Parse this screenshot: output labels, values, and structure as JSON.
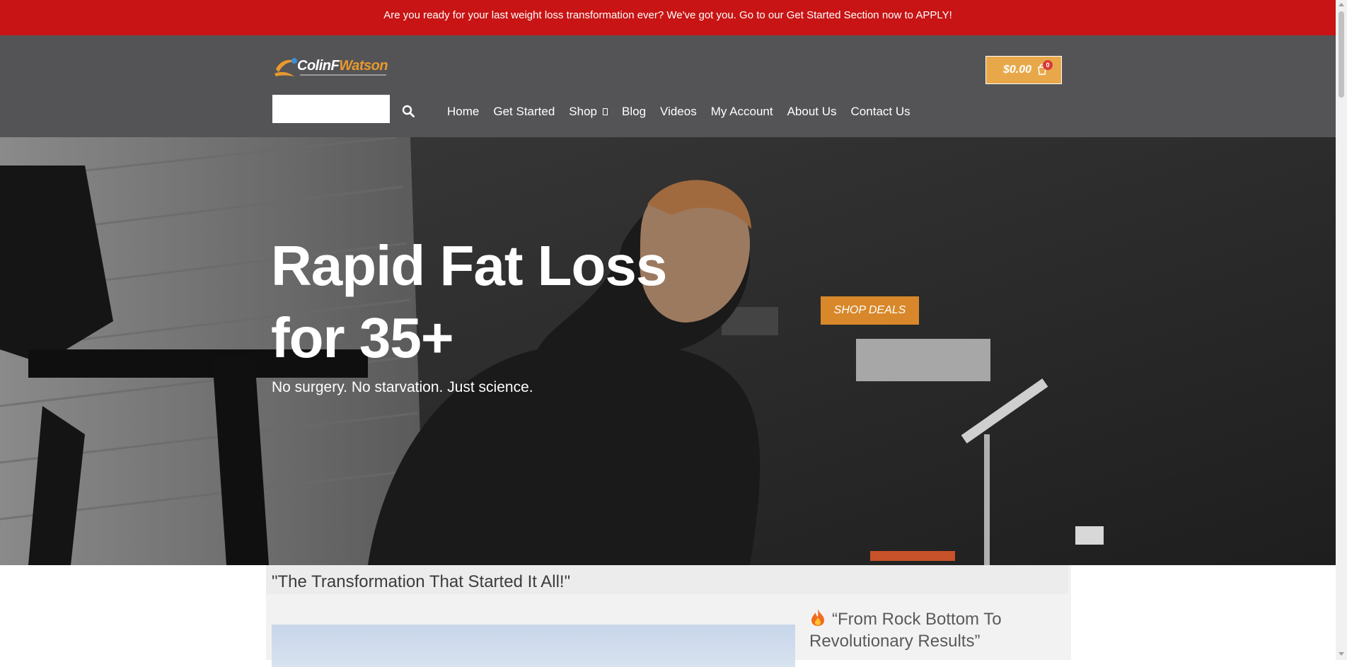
{
  "promo": {
    "text": "Are you ready for your last weight loss transformation ever? We've got you. Go to our Get Started Section now to APPLY!",
    "background": "#c81414"
  },
  "header": {
    "logo": {
      "text_main": "ColinF",
      "text_accent": "Watson"
    },
    "cart": {
      "amount": "$0.00",
      "count": "0",
      "background": "#e8a84a"
    },
    "search": {
      "placeholder": "",
      "value": ""
    },
    "nav": [
      {
        "label": "Home"
      },
      {
        "label": "Get Started"
      },
      {
        "label": "Shop",
        "has_dropdown": true
      },
      {
        "label": "Blog"
      },
      {
        "label": "Videos"
      },
      {
        "label": "My Account"
      },
      {
        "label": "About Us"
      },
      {
        "label": "Contact Us"
      }
    ],
    "background": "#545456"
  },
  "hero": {
    "title_line1": "Rapid Fat Loss",
    "title_line2": "for 35+",
    "subtitle": "No surgery. No starvation. Just science.",
    "cta_label": "SHOP DEALS",
    "cta_color": "#d8882a"
  },
  "transformation": {
    "heading": "\"The Transformation That Started It All!\"",
    "story_title": "“From Rock Bottom To Revolutionary Results”",
    "story_icon": "fire-icon"
  }
}
